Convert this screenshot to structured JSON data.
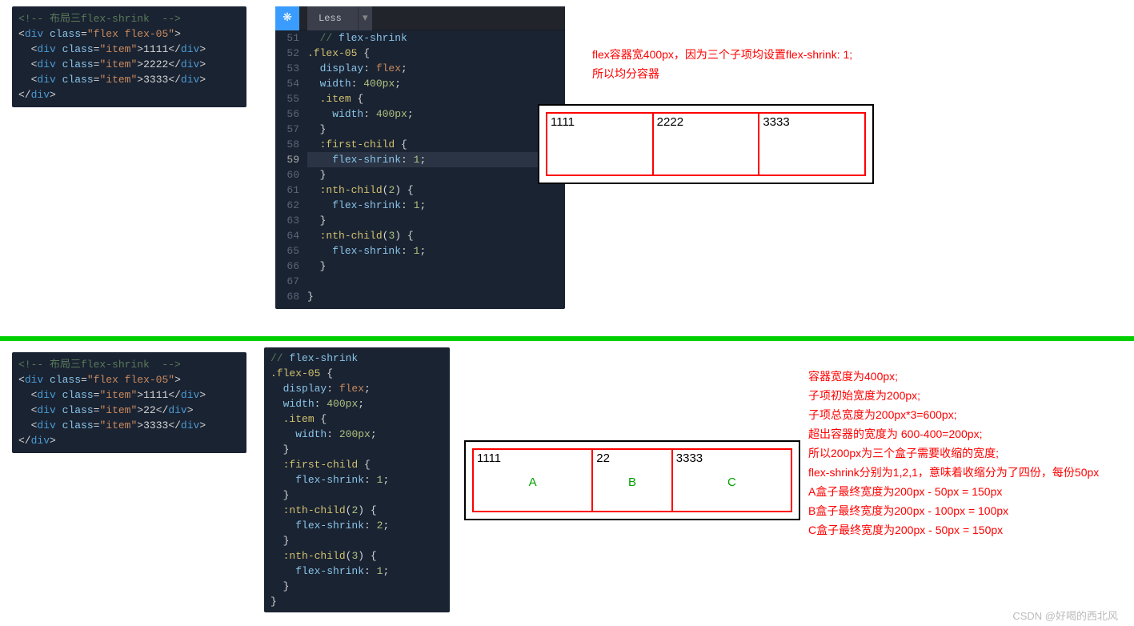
{
  "editor": {
    "tab": "Less",
    "icon_text": "❋"
  },
  "html1": {
    "comment": "<!-- 布局三flex-shrink  -->",
    "l1": "<div class=\"flex flex-05\">",
    "l2": "  <div class=\"item\">1111</div>",
    "l3": "  <div class=\"item\">2222</div>",
    "l4": "  <div class=\"item\">3333</div>",
    "l5": "</div>"
  },
  "html2": {
    "comment": "<!-- 布局三flex-shrink  -->",
    "l1": "<div class=\"flex flex-05\">",
    "l2": "  <div class=\"item\">1111</div>",
    "l3": "  <div class=\"item\">22</div>",
    "l4": "  <div class=\"item\">3333</div>",
    "l5": "</div>"
  },
  "css1": {
    "lines": [
      {
        "n": "51",
        "t": "  // flex-shrink",
        "cls": "cm"
      },
      {
        "n": "52",
        "t": ".flex-05 {"
      },
      {
        "n": "53",
        "t": "  display: flex;"
      },
      {
        "n": "54",
        "t": "  width: 400px;"
      },
      {
        "n": "55",
        "t": "  .item {"
      },
      {
        "n": "56",
        "t": "    width: 400px;"
      },
      {
        "n": "57",
        "t": "  }"
      },
      {
        "n": "58",
        "t": "  :first-child {"
      },
      {
        "n": "59",
        "t": "    flex-shrink: 1;",
        "cur": true
      },
      {
        "n": "60",
        "t": "  }"
      },
      {
        "n": "61",
        "t": "  :nth-child(2) {"
      },
      {
        "n": "62",
        "t": "    flex-shrink: 1;"
      },
      {
        "n": "63",
        "t": "  }"
      },
      {
        "n": "64",
        "t": "  :nth-child(3) {"
      },
      {
        "n": "65",
        "t": "    flex-shrink: 1;"
      },
      {
        "n": "66",
        "t": "  }"
      },
      {
        "n": "67",
        "t": ""
      },
      {
        "n": "68",
        "t": "}"
      }
    ]
  },
  "css2": {
    "lines": [
      "// flex-shrink",
      ".flex-05 {",
      "  display: flex;",
      "  width: 400px;",
      "  .item {",
      "    width: 200px;",
      "  }",
      "  :first-child {",
      "    flex-shrink: 1;",
      "  }",
      "  :nth-child(2) {",
      "    flex-shrink: 2;",
      "  }",
      "  :nth-child(3) {",
      "    flex-shrink: 1;",
      "  }",
      "}"
    ]
  },
  "anno1": {
    "l1": "flex容器宽400px，因为三个子项均设置flex-shrink: 1;",
    "l2": "所以均分容器"
  },
  "demo1": {
    "i1": "1111",
    "i2": "2222",
    "i3": "3333",
    "w1": 133,
    "w2": 133,
    "w3": 133
  },
  "anno2": {
    "l1": "容器宽度为400px;",
    "l2": "子项初始宽度为200px;",
    "l3": "子项总宽度为200px*3=600px;",
    "l4": "超出容器的宽度为 600-400=200px;",
    "l5": "所以200px为三个盒子需要收缩的宽度;",
    "l6": "flex-shrink分别为1,2,1，意味着收缩分为了四份，每份50px",
    "l7": "A盒子最终宽度为200px - 50px = 150px",
    "l8": "B盒子最终宽度为200px - 100px = 100px",
    "l9": "C盒子最终宽度为200px - 50px = 150px"
  },
  "demo2": {
    "i1": "1111",
    "i2": "22",
    "i3": "3333",
    "a": "A",
    "b": "B",
    "c": "C"
  },
  "watermark": "CSDN @好喝的西北风"
}
